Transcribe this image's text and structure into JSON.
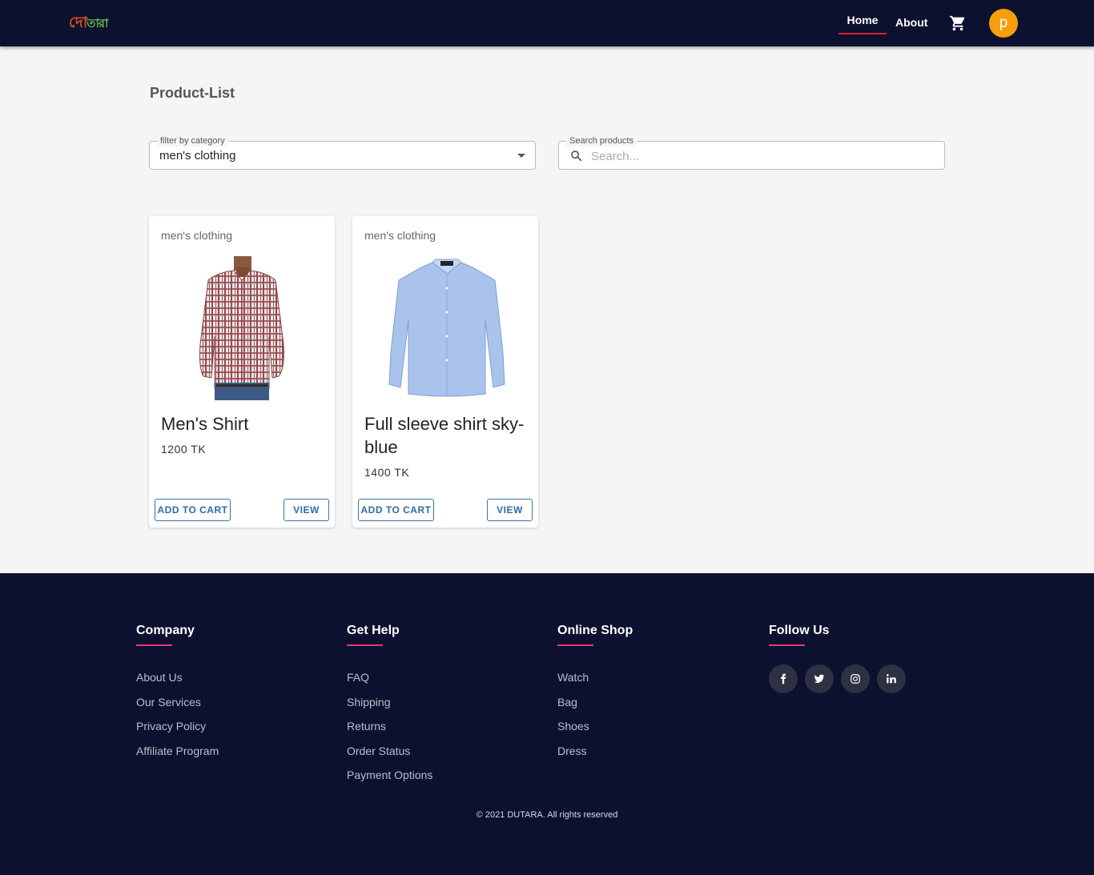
{
  "header": {
    "logo_part1": "দো",
    "logo_part2": "তারা",
    "nav": {
      "home": "Home",
      "about": "About"
    },
    "avatar_letter": "p",
    "icons": {
      "cart": "cart-icon"
    }
  },
  "main": {
    "page_title": "Product-List",
    "filter": {
      "label": "filter by category",
      "value": "men's clothing"
    },
    "search": {
      "label": "Search products",
      "placeholder": "Search..."
    },
    "products": [
      {
        "category": "men's clothing",
        "title": "Men's Shirt",
        "price": "1200 TK",
        "add_label": "ADD TO CART",
        "view_label": "VIEW",
        "image": "checked-shirt-model"
      },
      {
        "category": "men's clothing",
        "title": "Full sleeve shirt sky-blue",
        "price": "1400 TK",
        "add_label": "ADD TO CART",
        "view_label": "VIEW",
        "image": "sky-blue-shirt"
      }
    ]
  },
  "footer": {
    "company": {
      "title": "Company",
      "links": [
        "About Us",
        "Our Services",
        "Privacy Policy",
        "Affiliate Program"
      ]
    },
    "help": {
      "title": "Get Help",
      "links": [
        "FAQ",
        "Shipping",
        "Returns",
        "Order Status",
        "Payment Options"
      ]
    },
    "shop": {
      "title": "Online Shop",
      "links": [
        "Watch",
        "Bag",
        "Shoes",
        "Dress"
      ]
    },
    "follow": {
      "title": "Follow Us",
      "icons": [
        "facebook-icon",
        "twitter-icon",
        "instagram-icon",
        "linkedin-icon"
      ]
    },
    "copyright": "© 2021 DUTARA. All rights reserved"
  },
  "colors": {
    "header_bg": "#0d1130",
    "nav_active_underline": "#d8222d",
    "avatar": "#f59f0a",
    "footer_accent": "#e83a6a",
    "button_text": "#2e6ca5"
  }
}
